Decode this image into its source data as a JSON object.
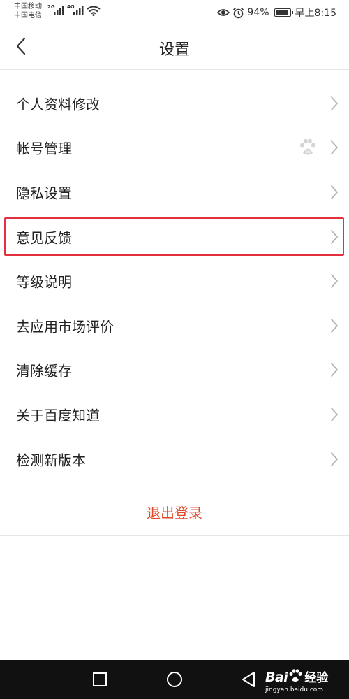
{
  "status_bar": {
    "carrier_1": "中国移动",
    "carrier_2": "中国电信",
    "signal_1_type": "2G",
    "signal_2_type": "4G",
    "battery_percent": "94%",
    "battery_level": 0.94,
    "time": "早上8:15",
    "icons": [
      "signal-icon",
      "wifi-icon",
      "eye-icon",
      "alarm-icon",
      "battery-icon"
    ]
  },
  "header": {
    "title": "设置",
    "back_icon": "chevron-left-icon"
  },
  "menu": [
    {
      "label": "个人资料修改",
      "highlighted": false,
      "badge_icon": null
    },
    {
      "label": "帐号管理",
      "highlighted": false,
      "badge_icon": "baidu-paw-icon"
    },
    {
      "label": "隐私设置",
      "highlighted": false,
      "badge_icon": null
    },
    {
      "label": "意见反馈",
      "highlighted": true,
      "badge_icon": null
    },
    {
      "label": "等级说明",
      "highlighted": false,
      "badge_icon": null
    },
    {
      "label": "去应用市场评价",
      "highlighted": false,
      "badge_icon": null
    },
    {
      "label": "清除缓存",
      "highlighted": false,
      "badge_icon": null
    },
    {
      "label": "关于百度知道",
      "highlighted": false,
      "badge_icon": null
    },
    {
      "label": "检测新版本",
      "highlighted": false,
      "badge_icon": null
    }
  ],
  "logout": {
    "label": "退出登录"
  },
  "nav_bar": {
    "icons": [
      "square-icon",
      "circle-icon",
      "triangle-back-icon"
    ]
  },
  "watermark": {
    "brand": "Bai",
    "text": "经验",
    "url": "jingyan.baidu.com"
  },
  "colors": {
    "accent_red": "#e04a2b",
    "highlight_border": "#e3303e",
    "divider": "#e6e6e6",
    "chevron": "#b5b5b5",
    "nav_bar": "#111111"
  }
}
